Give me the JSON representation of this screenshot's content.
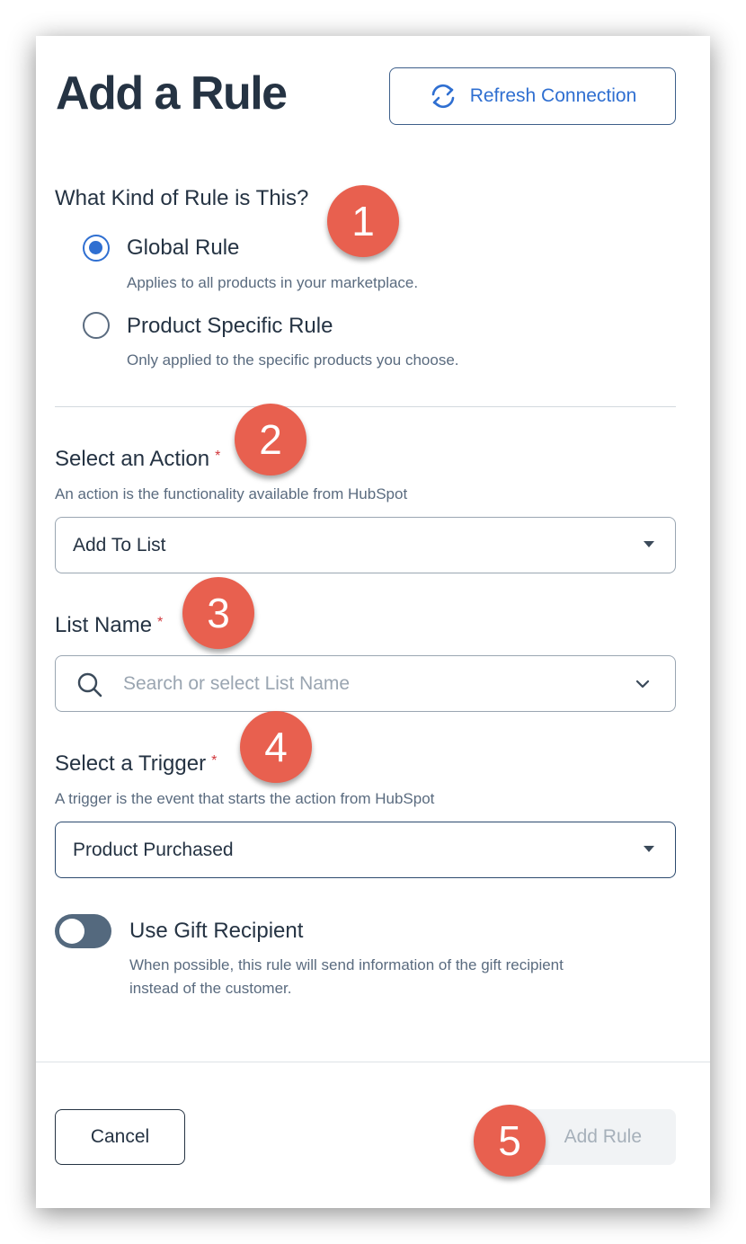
{
  "header": {
    "title": "Add a Rule",
    "refresh_label": "Refresh Connection"
  },
  "rule_kind": {
    "label": "What Kind of Rule is This?",
    "options": [
      {
        "label": "Global Rule",
        "description": "Applies to all products in your marketplace.",
        "checked": true
      },
      {
        "label": "Product Specific Rule",
        "description": "Only applied to the specific products you choose.",
        "checked": false
      }
    ]
  },
  "action": {
    "label": "Select an Action",
    "required_mark": "*",
    "help": "An action is the functionality available from HubSpot",
    "value": "Add To List"
  },
  "list_name": {
    "label": "List Name",
    "required_mark": "*",
    "placeholder": "Search or select List Name"
  },
  "trigger": {
    "label": "Select a Trigger",
    "required_mark": "*",
    "help": "A trigger is the event that starts the action from HubSpot",
    "value": "Product Purchased"
  },
  "gift_toggle": {
    "label": "Use Gift Recipient",
    "description_line1": "When possible, this rule will send information of the gift recipient",
    "description_line2": "instead of the customer.",
    "enabled": false
  },
  "footer": {
    "cancel_label": "Cancel",
    "add_label": "Add Rule"
  },
  "callouts": [
    "1",
    "2",
    "3",
    "4",
    "5"
  ],
  "colors": {
    "accent": "#2f6fd1",
    "heading": "#253343",
    "callout": "#e8604f",
    "toggle_off": "#54697e"
  }
}
